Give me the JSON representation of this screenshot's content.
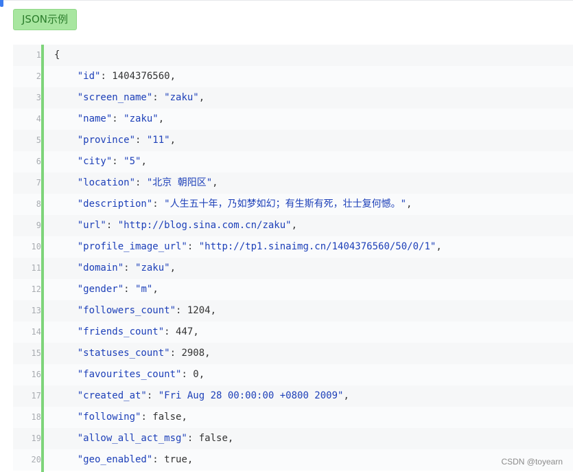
{
  "tag": {
    "label": "JSON示例"
  },
  "code": {
    "lines": [
      {
        "num": "1",
        "indent": "",
        "key": "",
        "sep": "",
        "value": "{",
        "value_type": "punct"
      },
      {
        "num": "2",
        "indent": "    ",
        "key": "\"id\"",
        "sep": ": ",
        "value": "1404376560",
        "value_type": "number",
        "tail": ","
      },
      {
        "num": "3",
        "indent": "    ",
        "key": "\"screen_name\"",
        "sep": ": ",
        "value": "\"zaku\"",
        "value_type": "string",
        "tail": ","
      },
      {
        "num": "4",
        "indent": "    ",
        "key": "\"name\"",
        "sep": ": ",
        "value": "\"zaku\"",
        "value_type": "string",
        "tail": ","
      },
      {
        "num": "5",
        "indent": "    ",
        "key": "\"province\"",
        "sep": ": ",
        "value": "\"11\"",
        "value_type": "string",
        "tail": ","
      },
      {
        "num": "6",
        "indent": "    ",
        "key": "\"city\"",
        "sep": ": ",
        "value": "\"5\"",
        "value_type": "string",
        "tail": ","
      },
      {
        "num": "7",
        "indent": "    ",
        "key": "\"location\"",
        "sep": ": ",
        "value": "\"北京 朝阳区\"",
        "value_type": "string",
        "tail": ","
      },
      {
        "num": "8",
        "indent": "    ",
        "key": "\"description\"",
        "sep": ": ",
        "value": "\"人生五十年，乃如梦如幻；有生斯有死，壮士复何憾。\"",
        "value_type": "string",
        "tail": ","
      },
      {
        "num": "9",
        "indent": "    ",
        "key": "\"url\"",
        "sep": ": ",
        "value": "\"http://blog.sina.com.cn/zaku\"",
        "value_type": "string",
        "tail": ","
      },
      {
        "num": "10",
        "indent": "    ",
        "key": "\"profile_image_url\"",
        "sep": ": ",
        "value": "\"http://tp1.sinaimg.cn/1404376560/50/0/1\"",
        "value_type": "string",
        "tail": ","
      },
      {
        "num": "11",
        "indent": "    ",
        "key": "\"domain\"",
        "sep": ": ",
        "value": "\"zaku\"",
        "value_type": "string",
        "tail": ","
      },
      {
        "num": "12",
        "indent": "    ",
        "key": "\"gender\"",
        "sep": ": ",
        "value": "\"m\"",
        "value_type": "string",
        "tail": ","
      },
      {
        "num": "13",
        "indent": "    ",
        "key": "\"followers_count\"",
        "sep": ": ",
        "value": "1204",
        "value_type": "number",
        "tail": ","
      },
      {
        "num": "14",
        "indent": "    ",
        "key": "\"friends_count\"",
        "sep": ": ",
        "value": "447",
        "value_type": "number",
        "tail": ","
      },
      {
        "num": "15",
        "indent": "    ",
        "key": "\"statuses_count\"",
        "sep": ": ",
        "value": "2908",
        "value_type": "number",
        "tail": ","
      },
      {
        "num": "16",
        "indent": "    ",
        "key": "\"favourites_count\"",
        "sep": ": ",
        "value": "0",
        "value_type": "number",
        "tail": ","
      },
      {
        "num": "17",
        "indent": "    ",
        "key": "\"created_at\"",
        "sep": ": ",
        "value": "\"Fri Aug 28 00:00:00 +0800 2009\"",
        "value_type": "string",
        "tail": ","
      },
      {
        "num": "18",
        "indent": "    ",
        "key": "\"following\"",
        "sep": ": ",
        "value": "false",
        "value_type": "keyword",
        "tail": ","
      },
      {
        "num": "19",
        "indent": "    ",
        "key": "\"allow_all_act_msg\"",
        "sep": ": ",
        "value": "false",
        "value_type": "keyword",
        "tail": ","
      },
      {
        "num": "20",
        "indent": "    ",
        "key": "\"geo_enabled\"",
        "sep": ": ",
        "value": "true",
        "value_type": "keyword",
        "tail": ","
      }
    ]
  },
  "watermark": {
    "text": "CSDN @toyearn"
  },
  "colors": {
    "tag_bg": "#a8e6a0",
    "tag_text": "#2b7d2b",
    "gutter_bar": "#7ed47a",
    "key_color": "#1c3fb8",
    "string_color": "#1c3fb8",
    "text_color": "#333333",
    "line_number_color": "#a8acb1",
    "accent_blue": "#3b7cf0"
  }
}
